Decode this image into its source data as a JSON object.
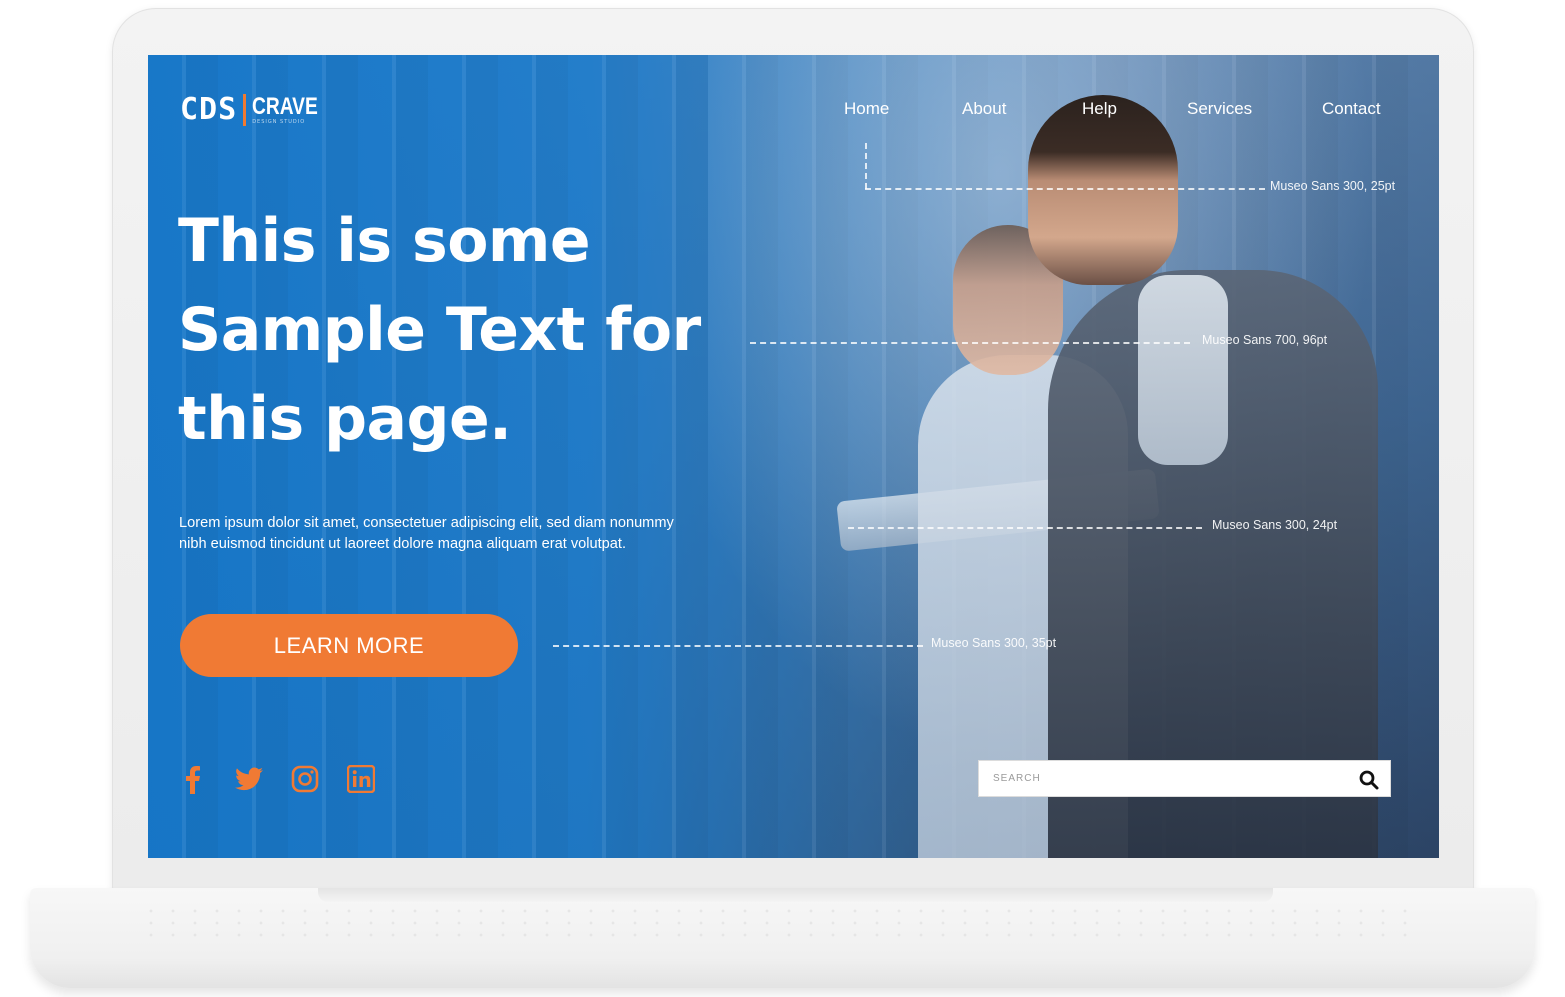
{
  "brand": {
    "mark": "CDS",
    "name": "CRAVE",
    "tagline": "DESIGN STUDIO"
  },
  "nav": {
    "items": [
      {
        "label": "Home"
      },
      {
        "label": "About"
      },
      {
        "label": "Help"
      },
      {
        "label": "Services"
      },
      {
        "label": "Contact"
      }
    ]
  },
  "hero": {
    "headline_lines": [
      "This is some",
      "Sample Text for",
      "this page."
    ],
    "body_lines": [
      "Lorem ipsum dolor sit amet, consectetuer adipiscing elit, sed diam nonummy",
      "nibh euismod tincidunt ut laoreet dolore magna aliquam erat volutpat."
    ],
    "cta_label": "LEARN MORE"
  },
  "annotations": {
    "nav_font": "Museo Sans 300, 25pt",
    "headline_font": "Museo Sans 700, 96pt",
    "body_font": "Museo Sans 300, 24pt",
    "button_font": "Museo Sans 300, 35pt"
  },
  "social": [
    {
      "icon": "facebook-icon"
    },
    {
      "icon": "twitter-icon"
    },
    {
      "icon": "instagram-icon"
    },
    {
      "icon": "linkedin-icon"
    }
  ],
  "search": {
    "placeholder": "SEARCH",
    "value": ""
  },
  "colors": {
    "accent": "#f07a34",
    "hero_blue": "#1677c9",
    "text": "#ffffff"
  }
}
